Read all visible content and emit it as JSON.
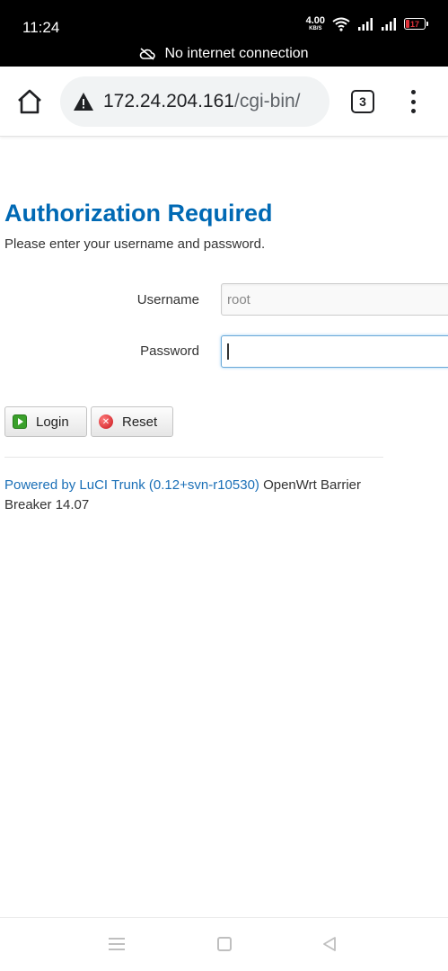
{
  "status_bar": {
    "time": "11:24",
    "speed_value": "4.00",
    "speed_unit": "KB/S",
    "battery_level": "17",
    "icons": [
      "wifi-icon",
      "signal-icon",
      "signal-icon",
      "battery-icon"
    ]
  },
  "connection_banner": {
    "text": "No internet connection",
    "icon": "cloud-off-icon"
  },
  "browser": {
    "url_host": "172.24.204.161",
    "url_path": "/cgi-bin/",
    "tab_count": "3",
    "icons": [
      "home-icon",
      "warning-icon",
      "tab-switcher-icon",
      "more-vert-icon"
    ]
  },
  "page": {
    "title": "Authorization Required",
    "description": "Please enter your username and password.",
    "username_label": "Username",
    "username_value": "root",
    "password_label": "Password",
    "password_value": "",
    "login_label": "Login",
    "reset_label": "Reset",
    "footer_link": "Powered by LuCI Trunk (0.12+svn-r10530)",
    "footer_text": " OpenWrt Barrier Breaker 14.07"
  },
  "colors": {
    "title": "#0069b4",
    "link": "#1a6fb7",
    "login_icon": "#3aa02b",
    "reset_icon": "#c9161c"
  }
}
